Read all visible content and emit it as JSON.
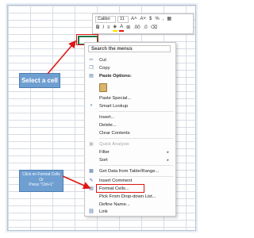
{
  "mini_toolbar": {
    "font_name": "Calibri",
    "font_size": "11",
    "increase_font": "A˄",
    "decrease_font": "A˅",
    "currency": "$",
    "percent": "%",
    "comma": ",",
    "bold": "B",
    "italic": "I",
    "fill_color_icon": "fill-bucket-icon",
    "font_color_icon": "font-color-icon",
    "borders_icon": "borders-icon",
    "increase_decimal": ".00",
    "decrease_decimal": ".0",
    "merge_icon": "merge-icon"
  },
  "context_menu": {
    "search_placeholder": "Search the menus",
    "items": [
      {
        "label": "Cut",
        "icon": "scissors-icon"
      },
      {
        "label": "Copy",
        "icon": "copy-icon"
      },
      {
        "label": "Paste Options:",
        "icon": "paste-icon"
      },
      {
        "label": "Paste Special...",
        "icon": ""
      },
      {
        "label": "Smart Lookup",
        "icon": "search-icon"
      },
      {
        "label": "Insert...",
        "icon": ""
      },
      {
        "label": "Delete...",
        "icon": ""
      },
      {
        "label": "Clear Contents",
        "icon": ""
      },
      {
        "label": "Quick Analysis",
        "icon": "quick-analysis-icon"
      },
      {
        "label": "Filter",
        "icon": ""
      },
      {
        "label": "Sort",
        "icon": ""
      },
      {
        "label": "Get Data from Table/Range...",
        "icon": "table-icon"
      },
      {
        "label": "Insert Comment",
        "icon": "comment-icon"
      },
      {
        "label": "Format Cells...",
        "icon": "format-cells-icon"
      },
      {
        "label": "Pick From Drop-down List...",
        "icon": ""
      },
      {
        "label": "Define Name...",
        "icon": ""
      },
      {
        "label": "Link",
        "icon": "link-icon"
      }
    ]
  },
  "callouts": {
    "select_cell": "Select a cell",
    "format_line1": "Click on Format Cells",
    "format_line2": "Or",
    "format_line3": "Press \"Ctrl+1\""
  },
  "colors": {
    "highlight_red": "#e01515",
    "callout_blue": "#6f9fd1",
    "selection_green": "#217346"
  }
}
